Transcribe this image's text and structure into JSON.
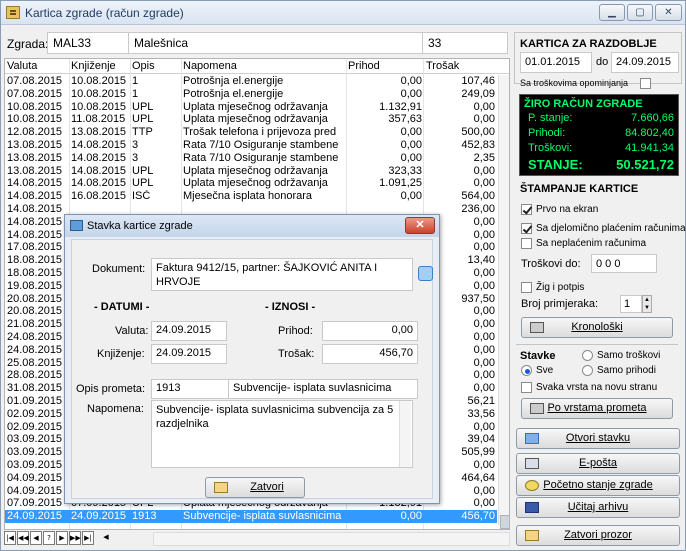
{
  "window": {
    "title": "Kartica zgrade (račun zgrade)"
  },
  "header": {
    "label": "Zgrada:",
    "code": "MAL33",
    "name": "Malešnica",
    "count": "33"
  },
  "grid": {
    "columns": [
      "Valuta",
      "Knjiženje",
      "Opis",
      "Napomena",
      "Prihod",
      "Trošak"
    ],
    "rows": [
      [
        "07.08.2015",
        "10.08.2015",
        "1",
        "Potrošnja el.energije",
        "0,00",
        "107,46"
      ],
      [
        "07.08.2015",
        "10.08.2015",
        "1",
        "Potrošnja el.energije",
        "0,00",
        "249,09"
      ],
      [
        "10.08.2015",
        "10.08.2015",
        "UPL",
        "Uplata mjesečnog održavanja",
        "1.132,91",
        "0,00"
      ],
      [
        "10.08.2015",
        "11.08.2015",
        "UPL",
        "Uplata mjesečnog održavanja",
        "357,63",
        "0,00"
      ],
      [
        "12.08.2015",
        "13.08.2015",
        "TTP",
        "Trošak telefona i prijevoza pred",
        "0,00",
        "500,00"
      ],
      [
        "13.08.2015",
        "14.08.2015",
        "3",
        "Rata 7/10 Osiguranje stambene",
        "0,00",
        "452,83"
      ],
      [
        "13.08.2015",
        "14.08.2015",
        "3",
        "Rata 7/10 Osiguranje stambene",
        "0,00",
        "2,35"
      ],
      [
        "13.08.2015",
        "14.08.2015",
        "UPL",
        "Uplata mjesečnog održavanja",
        "323,33",
        "0,00"
      ],
      [
        "14.08.2015",
        "14.08.2015",
        "UPL",
        "Uplata mjesečnog održavanja",
        "1.091,25",
        "0,00"
      ],
      [
        "14.08.2015",
        "16.08.2015",
        "ISČ",
        "Mjesečna isplata honorara",
        "0,00",
        "564,00"
      ],
      [
        "14.08.2015",
        "",
        "",
        "",
        "",
        "236,00"
      ],
      [
        "14.08.2015",
        "",
        "",
        "",
        "",
        "0,00"
      ],
      [
        "14.08.2015",
        "",
        "",
        "",
        "",
        "0,00"
      ],
      [
        "17.08.2015",
        "",
        "",
        "",
        "",
        "0,00"
      ],
      [
        "18.08.2015",
        "",
        "",
        "",
        "",
        "13,40"
      ],
      [
        "18.08.2015",
        "",
        "",
        "",
        "",
        "0,00"
      ],
      [
        "19.08.2015",
        "",
        "",
        "",
        "",
        "0,00"
      ],
      [
        "20.08.2015",
        "",
        "",
        "",
        "",
        "937,50"
      ],
      [
        "20.08.2015",
        "",
        "",
        "",
        "",
        "0,00"
      ],
      [
        "21.08.2015",
        "",
        "",
        "",
        "",
        "0,00"
      ],
      [
        "24.08.2015",
        "",
        "",
        "",
        "",
        "0,00"
      ],
      [
        "24.08.2015",
        "",
        "",
        "",
        "",
        "0,00"
      ],
      [
        "25.08.2015",
        "",
        "",
        "",
        "",
        "0,00"
      ],
      [
        "28.08.2015",
        "",
        "",
        "",
        "",
        "0,00"
      ],
      [
        "31.08.2015",
        "",
        "",
        "",
        "",
        "0,00"
      ],
      [
        "01.09.2015",
        "",
        "",
        "",
        "",
        "56,21"
      ],
      [
        "02.09.2015",
        "",
        "",
        "",
        "",
        "33,56"
      ],
      [
        "02.09.2015",
        "",
        "",
        "",
        "",
        "0,00"
      ],
      [
        "03.09.2015",
        "",
        "",
        "",
        "",
        "39,04"
      ],
      [
        "03.09.2015",
        "",
        "",
        "",
        "",
        "505,99"
      ],
      [
        "03.09.2015",
        "",
        "",
        "",
        "",
        "0,00"
      ],
      [
        "04.09.2015",
        "",
        "",
        "",
        "",
        "464,64"
      ],
      [
        "04.09.2015",
        "",
        "",
        "",
        "",
        "0,00"
      ],
      [
        "07.09.2015",
        "07.09.2015",
        "UPL",
        "Uplata mjesečnog održavanja",
        "1.132,91",
        "0,00"
      ],
      [
        "24.09.2015",
        "24.09.2015",
        "1913",
        "Subvencije- isplata suvlasnicima",
        "0,00",
        "456,70"
      ]
    ]
  },
  "panel": {
    "title": "KARTICA ZA RAZDOBLJE",
    "date_from": "01.01.2015",
    "date_to_label": "do",
    "date_to": "24.09.2015",
    "opening_label": "Sa troškovima opominjanja",
    "account": {
      "title": "ŽIRO RAČUN ZGRADE",
      "p_label": "P. stanje:",
      "p_value": "7.660,66",
      "inc_label": "Prihodi:",
      "inc_value": "84.802,40",
      "exp_label": "Troškovi:",
      "exp_value": "41.941,34",
      "bal_label": "STANJE:",
      "bal_value": "50.521,72"
    },
    "print_title": "ŠTAMPANJE KARTICE",
    "print_screen": "Prvo na ekran",
    "partial_paid": "Sa djelomično plaćenim računima",
    "unpaid": "Sa neplaćenim računima",
    "costs_to_label": "Troškovi do:",
    "costs_to_value": "0 0 0",
    "stamp": "Žig i potpis",
    "copies_label": "Broj primjeraka:",
    "copies_value": "1",
    "chron_btn": "Kronološki",
    "items_title": "Stavke",
    "r_costs": "Samo troškovi",
    "r_all": "Sve",
    "r_income": "Samo prihodi",
    "new_page": "Svaka vrsta na novu stranu",
    "by_type_btn": "Po vrstama prometa",
    "open_btn": "Otvori stavku",
    "email_btn": "E-pošta",
    "initial_btn": "Početno stanje zgrade",
    "archive_btn": "Učitaj arhivu",
    "close_btn": "Zatvori prozor"
  },
  "dialog": {
    "title": "Stavka kartice zgrade",
    "doc_label": "Dokument:",
    "doc_value": "Faktura 9412/15, partner: ŠAJKOVIĆ ANITA I HRVOJE",
    "dates_title": "- DATUMI -",
    "val_label": "Valuta:",
    "val_value": "24.09.2015",
    "book_label": "Knjiženje:",
    "book_value": "24.09.2015",
    "amounts_title": "- IZNOSI -",
    "inc_label": "Prihod:",
    "inc_value": "0,00",
    "exp_label": "Trošak:",
    "exp_value": "456,70",
    "op_label": "Opis prometa:",
    "op_code": "1913",
    "op_name": "Subvencije- isplata suvlasnicima",
    "note_label": "Napomena:",
    "note_value": "Subvencije- isplata suvlasnicima subvencija za 5 razdjelnika",
    "close_btn": "Zatvori"
  }
}
